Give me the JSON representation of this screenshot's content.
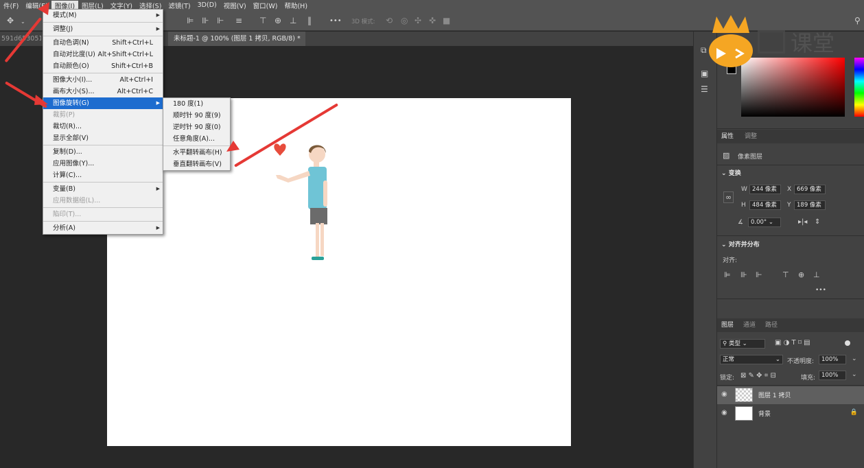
{
  "menubar": [
    "件(F)",
    "编辑(E)",
    "图像(I)",
    "图层(L)",
    "文字(Y)",
    "选择(S)",
    "滤镜(T)",
    "3D(D)",
    "视图(V)",
    "窗口(W)",
    "帮助(H)"
  ],
  "optionsbar": {
    "mode_3d": "3D 模式:",
    "more": "•••"
  },
  "tabs": {
    "left_partial": "591d6530516b",
    "active": "未标题-1 @ 100% (图层 1 拷贝, RGB/8) *",
    "close": "×"
  },
  "image_menu": [
    {
      "label": "模式(M)",
      "submenu": true
    },
    {
      "sep": true
    },
    {
      "label": "调整(J)",
      "submenu": true
    },
    {
      "sep": true
    },
    {
      "label": "自动色调(N)",
      "shortcut": "Shift+Ctrl+L"
    },
    {
      "label": "自动对比度(U)",
      "shortcut": "Alt+Shift+Ctrl+L"
    },
    {
      "label": "自动颜色(O)",
      "shortcut": "Shift+Ctrl+B"
    },
    {
      "sep": true
    },
    {
      "label": "图像大小(I)...",
      "shortcut": "Alt+Ctrl+I"
    },
    {
      "label": "画布大小(S)...",
      "shortcut": "Alt+Ctrl+C"
    },
    {
      "label": "图像旋转(G)",
      "submenu": true,
      "highlighted": true
    },
    {
      "label": "裁剪(P)",
      "disabled": true
    },
    {
      "label": "裁切(R)..."
    },
    {
      "label": "显示全部(V)"
    },
    {
      "sep": true
    },
    {
      "label": "复制(D)..."
    },
    {
      "label": "应用图像(Y)..."
    },
    {
      "label": "计算(C)..."
    },
    {
      "sep": true
    },
    {
      "label": "变量(B)",
      "submenu": true
    },
    {
      "label": "应用数据组(L)...",
      "disabled": true
    },
    {
      "sep": true
    },
    {
      "label": "陷印(T)...",
      "disabled": true
    },
    {
      "sep": true
    },
    {
      "label": "分析(A)",
      "submenu": true
    }
  ],
  "rotate_submenu": [
    {
      "label": "180 度(1)"
    },
    {
      "label": "顺时针 90 度(9)"
    },
    {
      "label": "逆时针 90 度(0)"
    },
    {
      "label": "任意角度(A)..."
    },
    {
      "sep": true
    },
    {
      "label": "水平翻转画布(H)"
    },
    {
      "label": "垂直翻转画布(V)"
    }
  ],
  "watermark": {
    "text": "课堂"
  },
  "properties": {
    "tabs": [
      "属性",
      "调整"
    ],
    "layer_type": "像素图层",
    "transform_header": "变换",
    "w_label": "W",
    "w_value": "244 像素",
    "x_label": "X",
    "x_value": "669 像素",
    "h_label": "H",
    "h_value": "484 像素",
    "y_label": "Y",
    "y_value": "189 像素",
    "angle": "0.00°",
    "align_header": "对齐并分布",
    "align_label": "对齐:",
    "more": "•••"
  },
  "layers_panel": {
    "tabs": [
      "图层",
      "通道",
      "路径"
    ],
    "kind_filter": "类型",
    "blend_mode": "正常",
    "opacity_label": "不透明度:",
    "opacity_value": "100%",
    "lock_label": "锁定:",
    "fill_label": "填充:",
    "fill_value": "100%",
    "layers": [
      {
        "name": "图层 1 拷贝",
        "selected": true
      },
      {
        "name": "背景",
        "locked": true
      }
    ]
  },
  "colors": {
    "menu_highlight": "#1d6ccf",
    "annotation_arrow": "#e53935",
    "watermark": "#f5a623"
  }
}
